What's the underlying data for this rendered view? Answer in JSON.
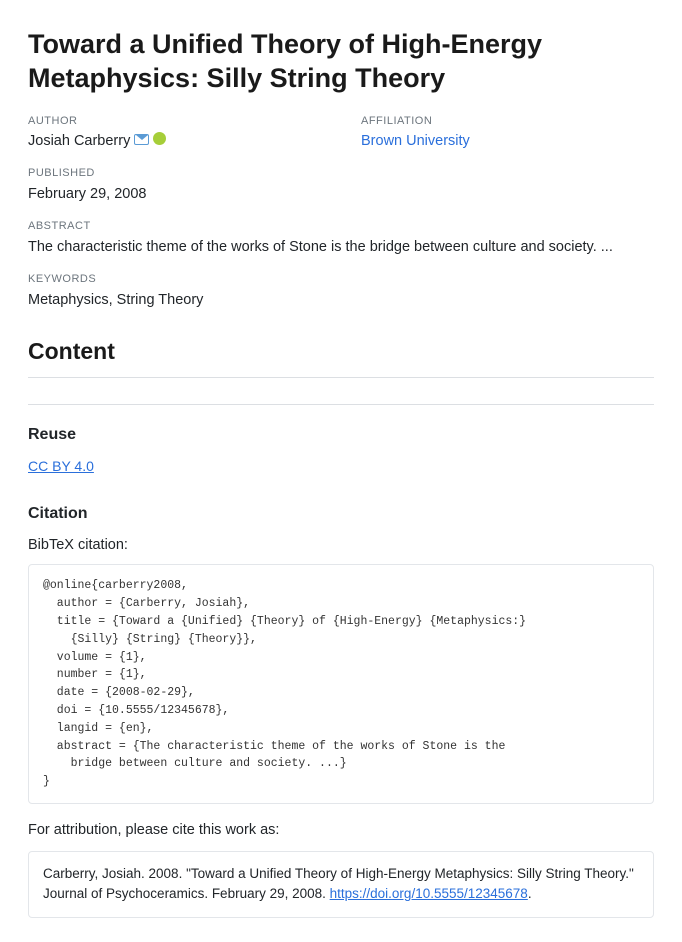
{
  "title": "Toward a Unified Theory of High-Energy Metaphysics: Silly String Theory",
  "labels": {
    "author": "AUTHOR",
    "affiliation": "AFFILIATION",
    "published": "PUBLISHED",
    "abstract": "ABSTRACT",
    "keywords": "KEYWORDS"
  },
  "author": {
    "name": "Josiah Carberry"
  },
  "affiliation": {
    "name": "Brown University"
  },
  "published": "February 29, 2008",
  "abstract": "The characteristic theme of the works of Stone is the bridge between culture and society. ...",
  "keywords": "Metaphysics, String Theory",
  "sections": {
    "content": "Content",
    "reuse": "Reuse",
    "citation": "Citation"
  },
  "reuse": {
    "license_label": "CC BY 4.0"
  },
  "citation": {
    "bibtex_intro": "BibTeX citation:",
    "bibtex": "@online{carberry2008,\n  author = {Carberry, Josiah},\n  title = {Toward a {Unified} {Theory} of {High-Energy} {Metaphysics:}\n    {Silly} {String} {Theory}},\n  volume = {1},\n  number = {1},\n  date = {2008-02-29},\n  doi = {10.5555/12345678},\n  langid = {en},\n  abstract = {The characteristic theme of the works of Stone is the\n    bridge between culture and society. ...}\n}",
    "attribution_intro": "For attribution, please cite this work as:",
    "attribution_pre": "Carberry, Josiah. 2008. \"Toward a Unified Theory of High-Energy Metaphysics: Silly String Theory.\" Journal of Psychoceramics. February 29, 2008. ",
    "doi_url": "https://doi.org/10.5555/12345678",
    "attribution_post": "."
  }
}
